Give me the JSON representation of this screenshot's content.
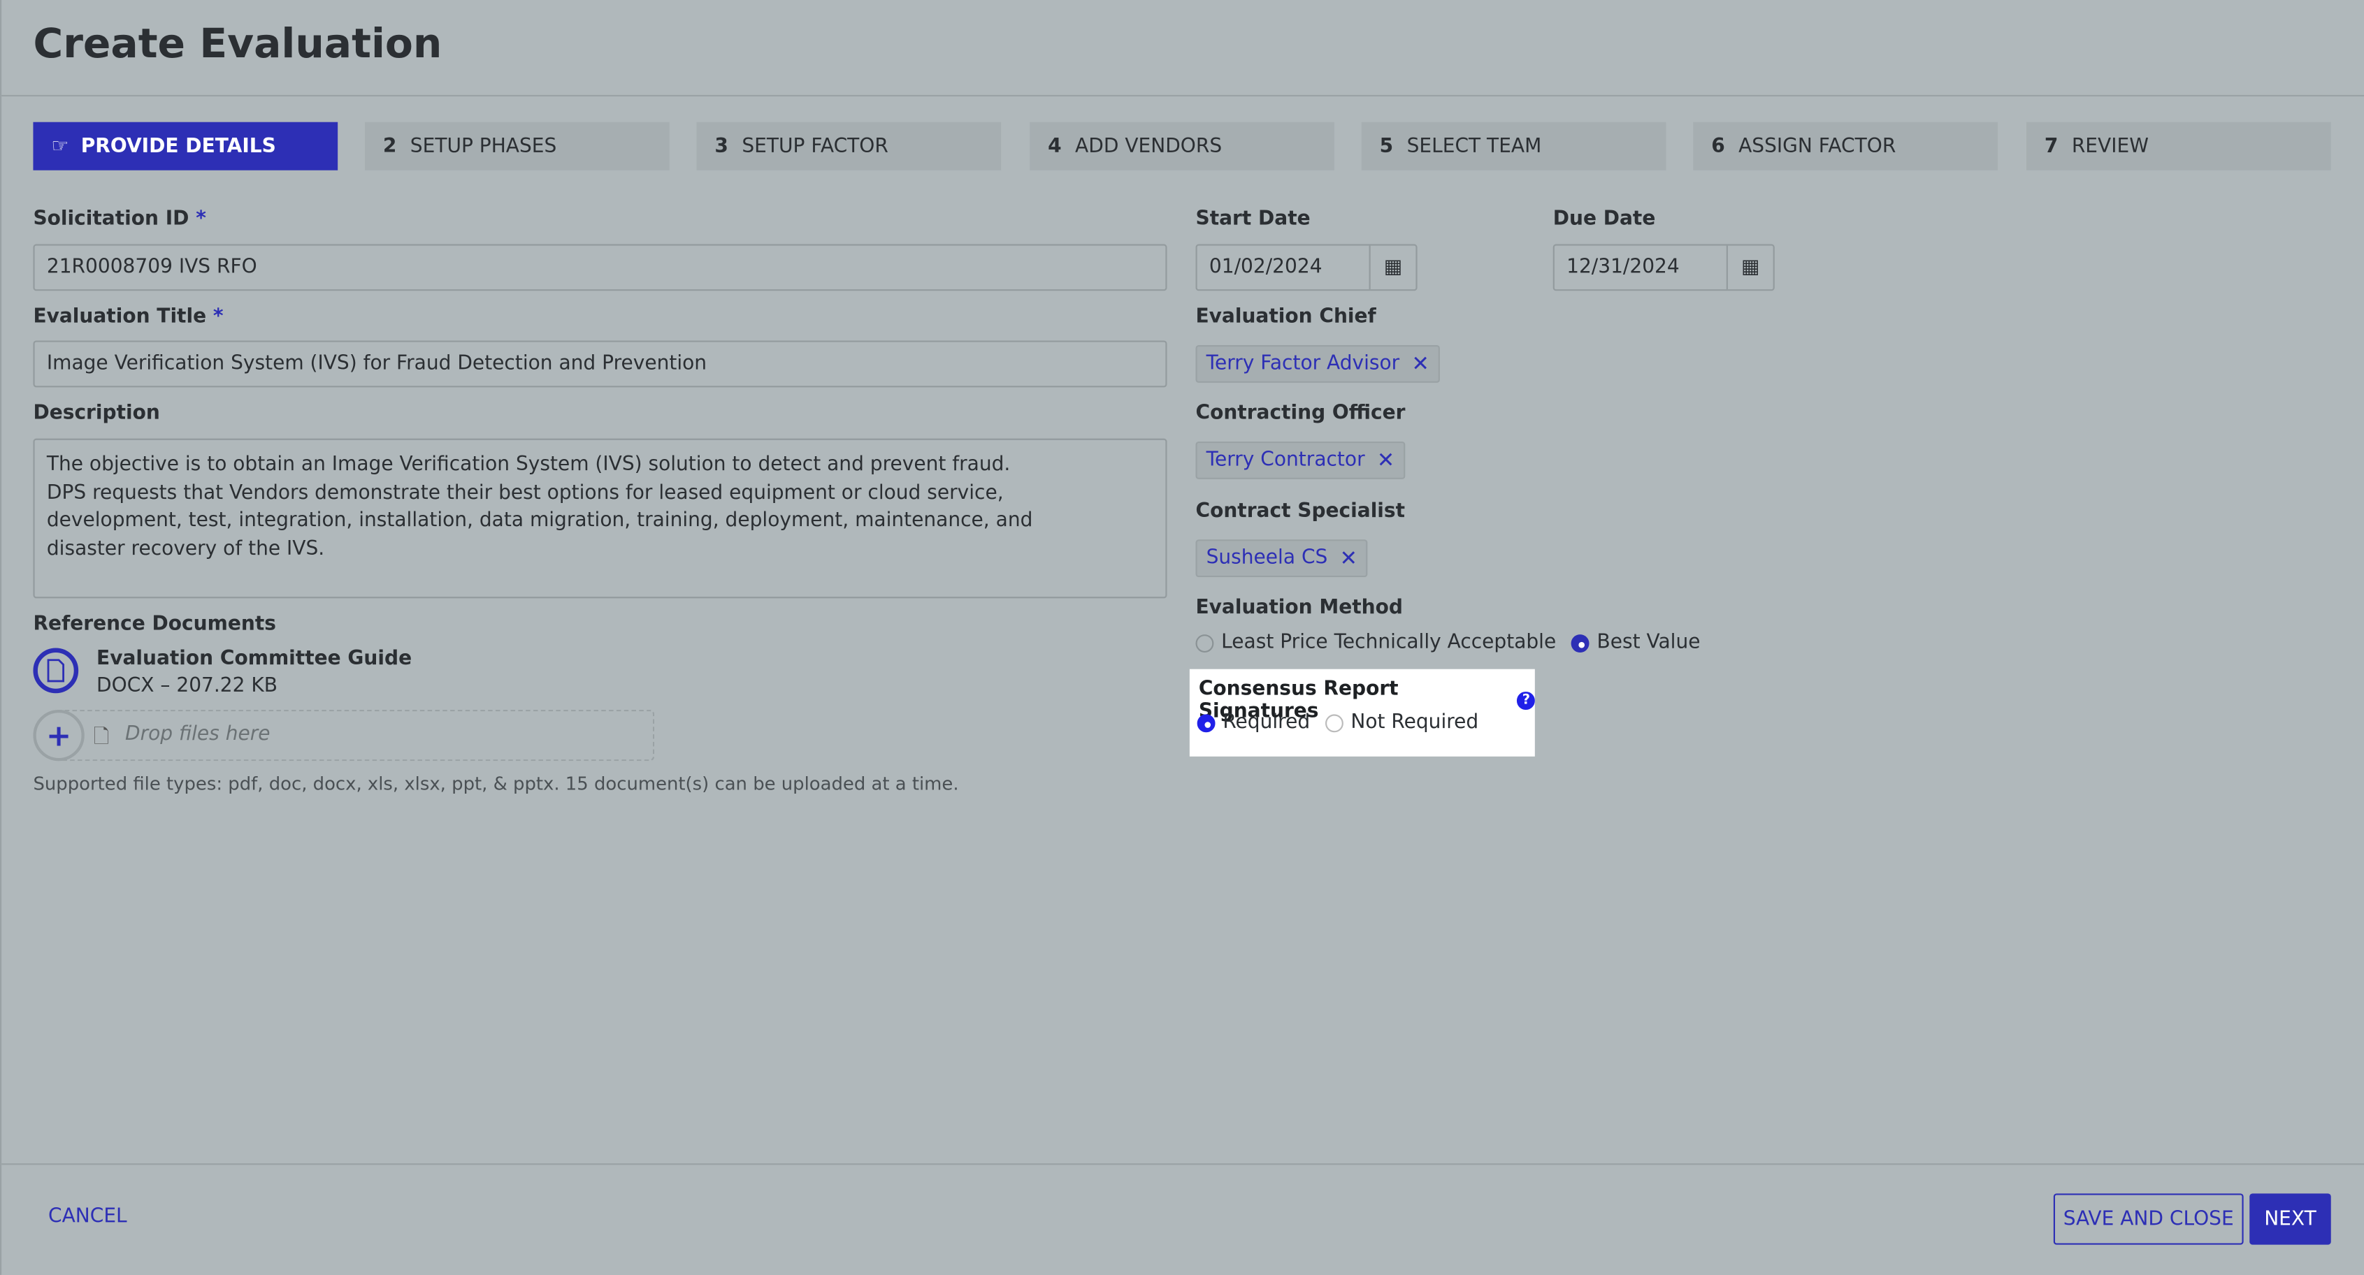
{
  "page_title": "Create Evaluation",
  "steps": [
    {
      "num": "",
      "label": "PROVIDE DETAILS",
      "active": true,
      "icon": "hand-pointing-icon"
    },
    {
      "num": "2",
      "label": "SETUP PHASES"
    },
    {
      "num": "3",
      "label": "SETUP FACTOR"
    },
    {
      "num": "4",
      "label": "ADD VENDORS"
    },
    {
      "num": "5",
      "label": "SELECT TEAM"
    },
    {
      "num": "6",
      "label": "ASSIGN FACTOR"
    },
    {
      "num": "7",
      "label": "REVIEW"
    }
  ],
  "form": {
    "solicitation_id": {
      "label": "Solicitation ID",
      "required_mark": "*",
      "value": "21R0008709 IVS RFO"
    },
    "evaluation_title": {
      "label": "Evaluation Title",
      "required_mark": "*",
      "value": "Image Verification System (IVS) for Fraud Detection and Prevention"
    },
    "description": {
      "label": "Description",
      "value": "The objective is to obtain an Image Verification System (IVS) solution to detect and prevent fraud.\nDPS requests that Vendors demonstrate their best options for leased equipment or cloud service,\ndevelopment, test, integration, installation, data migration, training, deployment, maintenance, and\ndisaster recovery of the IVS."
    },
    "reference_documents": {
      "label": "Reference Documents",
      "files": [
        {
          "name": "Evaluation Committee Guide",
          "meta": "DOCX – 207.22 KB"
        }
      ],
      "drop_placeholder": "Drop files here",
      "help": "Supported file types: pdf, doc, docx, xls, xlsx, ppt, & pptx. 15 document(s) can be uploaded at a time."
    },
    "start_date": {
      "label": "Start Date",
      "value": "01/02/2024"
    },
    "due_date": {
      "label": "Due Date",
      "value": "12/31/2024"
    },
    "evaluation_chief": {
      "label": "Evaluation Chief",
      "value": "Terry Factor Advisor"
    },
    "contracting_officer": {
      "label": "Contracting Officer",
      "value": "Terry Contractor"
    },
    "contract_specialist": {
      "label": "Contract Specialist",
      "value": "Susheela CS"
    },
    "evaluation_method": {
      "label": "Evaluation Method",
      "options": [
        "Least Price Technically Acceptable",
        "Best Value"
      ],
      "selected": "Best Value"
    },
    "consensus_signatures": {
      "label": "Consensus Report Signatures",
      "options": [
        "Required",
        "Not Required"
      ],
      "selected": "Required"
    }
  },
  "footer": {
    "cancel": "CANCEL",
    "save_close": "SAVE AND CLOSE",
    "next": "NEXT"
  },
  "colors": {
    "accent": "#2d2fb5",
    "background": "#b0b8bb",
    "highlight": "#ffffff"
  }
}
